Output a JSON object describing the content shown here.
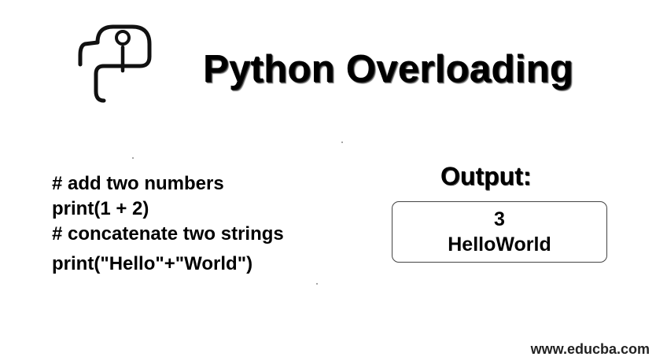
{
  "header": {
    "logo_icon": "python-logo-icon",
    "title": "Python Overloading"
  },
  "code": {
    "lines": [
      "# add two numbers",
      "print(1 + 2)",
      "# concatenate two strings",
      "print(\"Hello\"+\"World\")"
    ]
  },
  "output": {
    "label": "Output:",
    "lines": [
      "3",
      "HelloWorld"
    ]
  },
  "footer": {
    "watermark": "www.educba.com"
  }
}
